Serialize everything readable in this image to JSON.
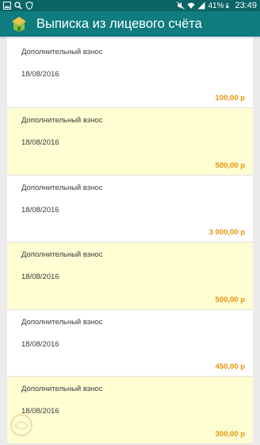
{
  "status_bar": {
    "battery_percent": "41%",
    "time": "23:49"
  },
  "app_bar": {
    "title": "Выписка из лицевого счёта"
  },
  "entries": [
    {
      "title": "Дополнительный взнос",
      "date": "18/08/2016",
      "amount": "100,00 р"
    },
    {
      "title": "Дополнительный взнос",
      "date": "18/08/2016",
      "amount": "500,00 р"
    },
    {
      "title": "Дополнительный взнос",
      "date": "18/08/2016",
      "amount": "3 000,00 р"
    },
    {
      "title": "Дополнительный взнос",
      "date": "18/08/2016",
      "amount": "500,00 р"
    },
    {
      "title": "Дополнительный взнос",
      "date": "18/08/2016",
      "amount": "450,00 р"
    },
    {
      "title": "Дополнительный взнос",
      "date": "18/08/2016",
      "amount": "300,00 р"
    }
  ],
  "colors": {
    "status_bar": "#0b6466",
    "app_bar": "#0f7c7f",
    "row_alt": "#fffdd2",
    "amount": "#e8940a"
  }
}
